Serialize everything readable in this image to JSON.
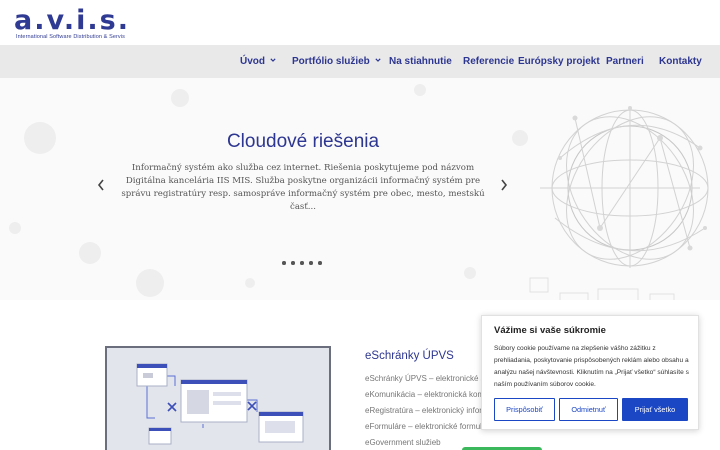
{
  "logo": {
    "mark": "a.v.i.s.",
    "tagline": "International Software Distribution & Servis"
  },
  "nav": {
    "items": [
      {
        "label": "Úvod",
        "has_dropdown": true
      },
      {
        "label": "Portfólio služieb",
        "has_dropdown": true
      },
      {
        "label": "Na stiahnutie",
        "has_dropdown": false
      },
      {
        "label": "Referencie",
        "has_dropdown": false
      },
      {
        "label": "Európsky projekt",
        "has_dropdown": false
      },
      {
        "label": "Partneri",
        "has_dropdown": false
      },
      {
        "label": "Kontakty",
        "has_dropdown": false
      }
    ]
  },
  "hero": {
    "title": "Cloudové riešenia",
    "text": "Informačný systém ako služba cez internet. Riešenia poskytujeme pod názvom Digitálna kancelária IIS MIS. Služba poskytne organizácii informačný systém pre správu registratúry resp. samospráve informačný systém pre obec, mesto, mestskú časť...",
    "prev_icon": "chevron-left-icon",
    "next_icon": "chevron-right-icon",
    "slide_count": 5,
    "active_slide": 1
  },
  "service": {
    "title": "eSchránky ÚPVS",
    "lines": [
      "eSchránky ÚPVS – elektronické schránky",
      "eKomunikácia – elektronická komunikácia",
      "eRegistratúra – elektronický informačný systém",
      "eFormuláre – elektronické formuláre",
      "eGovernment služieb"
    ]
  },
  "cookie": {
    "title": "Vážime si vaše súkromie",
    "text": "Súbory cookie používame na zlepšenie vášho zážitku z prehliadania, poskytovanie prispôsobených reklám alebo obsahu a analýzu našej návštevnosti. Kliknutím na „Prijať všetko“ súhlasíte s naším používaním súborov cookie.",
    "customize_label": "Prispôsobiť",
    "reject_label": "Odmietnuť",
    "accept_label": "Prijať všetko"
  },
  "colors": {
    "brand": "#2d3690",
    "nav_bg": "#e9e9ea",
    "cookie_button": "#1b47c5",
    "green_button": "#3bb85b"
  }
}
